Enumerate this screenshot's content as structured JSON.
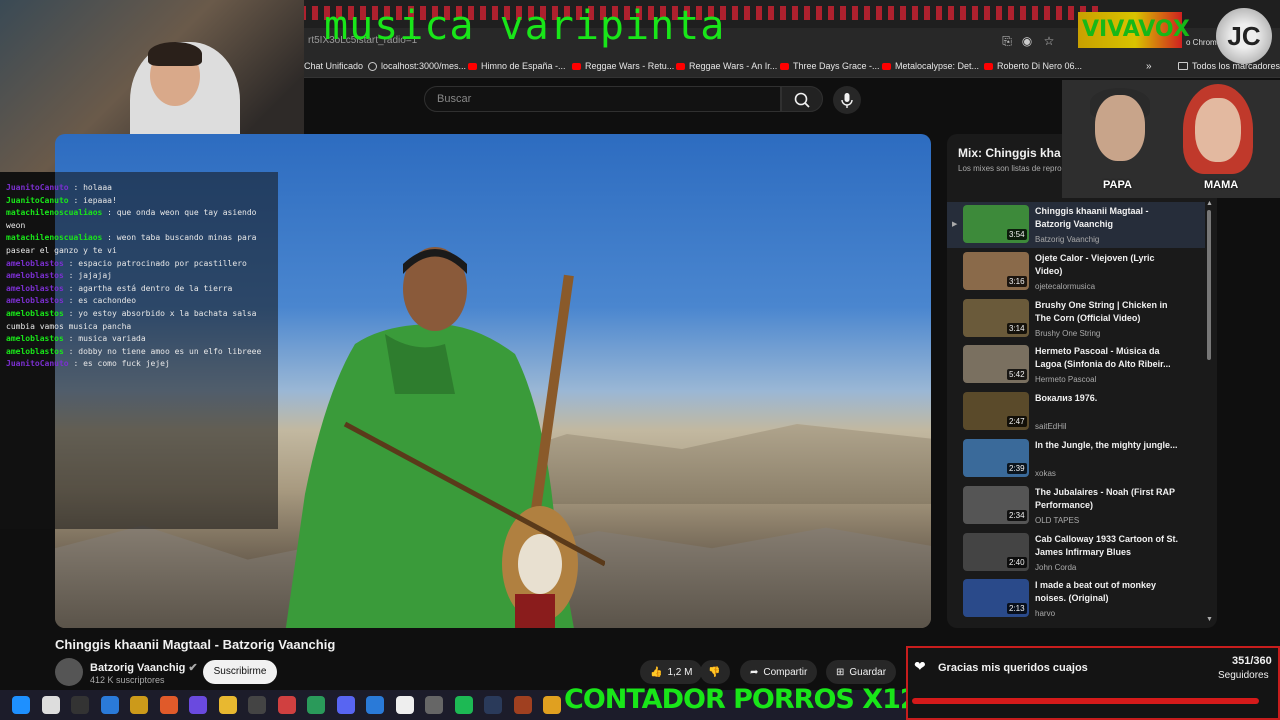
{
  "overlay": {
    "title": "musica varipinta",
    "brand": "VIVAVOX",
    "counter": "CONTADOR PORROS X12",
    "logo": "JC",
    "chrome_label": "o Chrome"
  },
  "browser": {
    "url": "rt5IX3oLc5lstart_radio=1",
    "bookmarks": [
      {
        "label": "Chat Unificado",
        "icon": "none"
      },
      {
        "label": "localhost:3000/mes...",
        "icon": "globe"
      },
      {
        "label": "Himno de España -...",
        "icon": "youtube"
      },
      {
        "label": "Reggae Wars - Retu...",
        "icon": "youtube"
      },
      {
        "label": "Reggae Wars - An Ir...",
        "icon": "youtube"
      },
      {
        "label": "Three Days Grace -...",
        "icon": "youtube"
      },
      {
        "label": "Metalocalypse: Det...",
        "icon": "youtube"
      },
      {
        "label": "Roberto Di Nero 06...",
        "icon": "youtube"
      }
    ],
    "all_bookmarks": "Todos los marcadores"
  },
  "youtube": {
    "search_placeholder": "Buscar",
    "video_title": "Chinggis khaanii Magtaal - Batzorig Vaanchig",
    "channel": "Batzorig Vaanchig",
    "subscribers": "412 K suscriptores",
    "subscribe": "Suscribirme",
    "likes": "1,2 M",
    "share": "Compartir",
    "save": "Guardar"
  },
  "playlist": {
    "title": "Mix: Chinggis kha",
    "subtitle": "Los mixes son listas de repro",
    "items": [
      {
        "title": "Chinggis khaanii Magtaal - Batzorig Vaanchig",
        "channel": "Batzorig Vaanchig",
        "duration": "3:54",
        "color": "#3d8a3a"
      },
      {
        "title": "Ojete Calor - Viejoven (Lyric Video)",
        "channel": "ojetecalormusica",
        "duration": "3:16",
        "color": "#8a6a4a"
      },
      {
        "title": "Brushy One String | Chicken in The Corn (Official Video)",
        "channel": "Brushy One String",
        "duration": "3:14",
        "color": "#6a5a3a"
      },
      {
        "title": "Hermeto Pascoal - Música da Lagoa (Sinfonia do Alto Ribeir...",
        "channel": "Hermeto Pascoal",
        "duration": "5:42",
        "color": "#7a7060"
      },
      {
        "title": "Вокализ 1976.",
        "channel": "saitEdHil",
        "duration": "2:47",
        "color": "#5a4a2a"
      },
      {
        "title": "In the Jungle, the mighty jungle...",
        "channel": "xokas",
        "duration": "2:39",
        "color": "#3a6a9a"
      },
      {
        "title": "The Jubalaires - Noah (First RAP Performance)",
        "channel": "OLD TAPES",
        "duration": "2:34",
        "color": "#555555"
      },
      {
        "title": "Cab Calloway 1933 Cartoon of St. James Infirmary Blues",
        "channel": "John Corda",
        "duration": "2:40",
        "color": "#444444"
      },
      {
        "title": "I made a beat out of monkey noises. (Original)",
        "channel": "harvo",
        "duration": "2:13",
        "color": "#2a4a8a"
      }
    ]
  },
  "chat": [
    {
      "user": "JuanitoCanuto",
      "text": "holaaa",
      "color": "#7b2fd0"
    },
    {
      "user": "JuanitoCanuto",
      "text": "iepaaa!",
      "color": "#19e619"
    },
    {
      "user": "matachilenoscualiaos",
      "text": "que onda weon que tay asiendo weon",
      "color": "#19e619"
    },
    {
      "user": "matachilenoscualiaos",
      "text": "weon taba buscando minas para pasear el ganzo y te vi",
      "color": "#19e619"
    },
    {
      "user": "ameloblastos",
      "text": "espacio patrocinado por pcastillero",
      "color": "#7b2fd0"
    },
    {
      "user": "ameloblastos",
      "text": "jajajaj",
      "color": "#7b2fd0"
    },
    {
      "user": "ameloblastos",
      "text": "agartha está dentro de la tierra",
      "color": "#7b2fd0"
    },
    {
      "user": "ameloblastos",
      "text": "es cachondeo",
      "color": "#7b2fd0"
    },
    {
      "user": "ameloblastos",
      "text": "yo estoy absorbido x la bachata salsa cumbia vamos musica pancha",
      "color": "#19e619"
    },
    {
      "user": "ameloblastos",
      "text": "musica variada",
      "color": "#19e619"
    },
    {
      "user": "ameloblastos",
      "text": "dobby no tiene amoo es un elfo libreee",
      "color": "#19e619"
    },
    {
      "user": "JuanitoCanuto",
      "text": "es como fuck jejej",
      "color": "#7b2fd0"
    }
  ],
  "webcam": {
    "left_label": "PAPA",
    "right_label": "MAMA"
  },
  "followers": {
    "message": "Gracias mis queridos cuajos",
    "count": "351/360",
    "label": "Seguidores",
    "progress": 0.975
  },
  "taskbar_icons": [
    "windows-icon",
    "search-icon",
    "cursor-icon",
    "vscode-icon",
    "files-icon",
    "app-icon",
    "v-icon",
    "folder-icon",
    "obs-icon",
    "chrome-icon",
    "shield-icon",
    "discord-icon",
    "vscode-blue-icon",
    "capcut-icon",
    "box-icon",
    "spotify-icon",
    "steam-icon",
    "game-icon",
    "chrome-active-icon"
  ]
}
